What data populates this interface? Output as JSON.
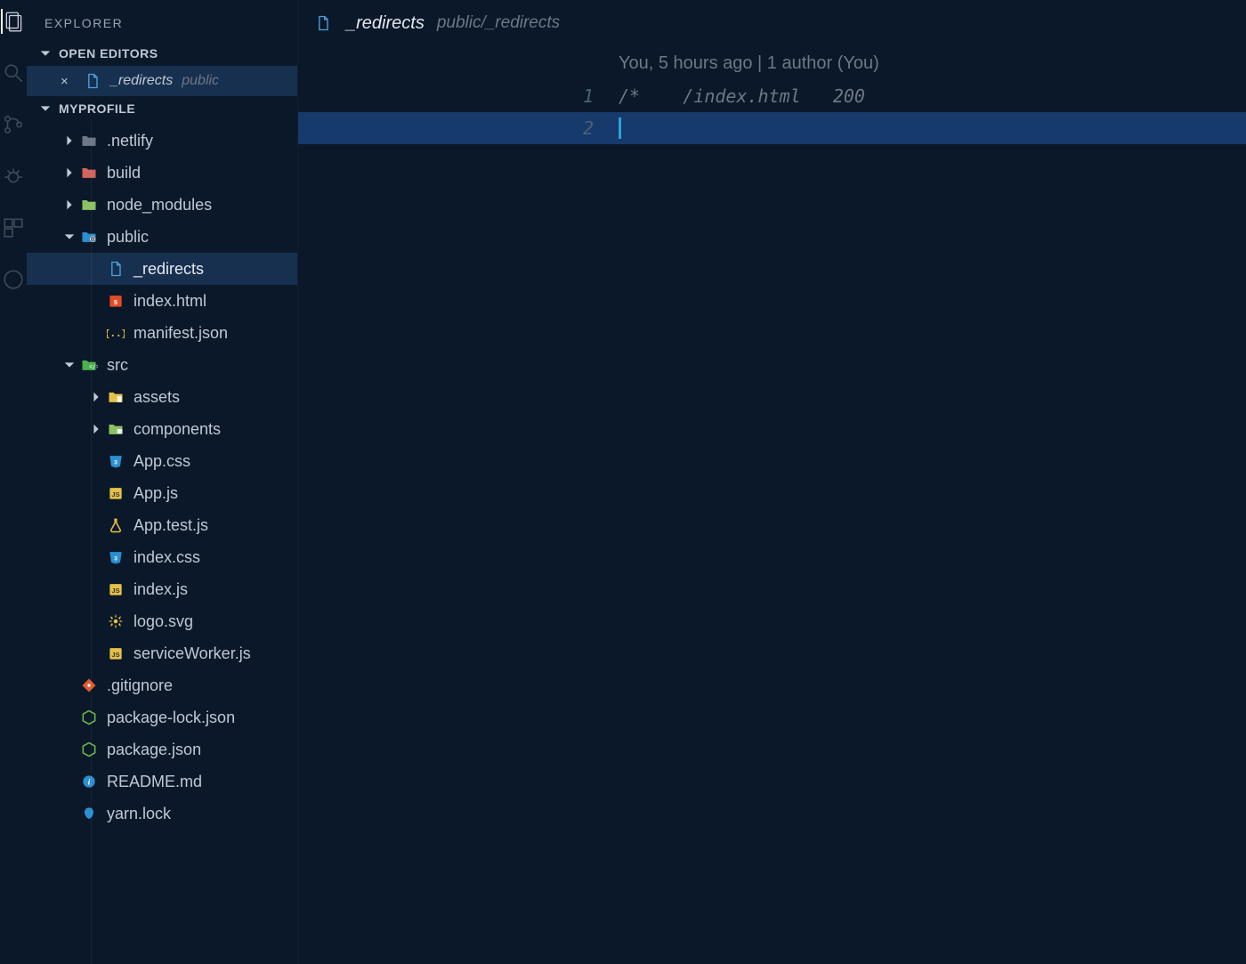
{
  "sidebar": {
    "title": "EXPLORER",
    "open_editors_label": "OPEN EDITORS",
    "open_editor": {
      "name": "_redirects",
      "path": "public"
    },
    "project_label": "MYPROFILE",
    "tree": [
      {
        "lvl": 0,
        "kind": "folder",
        "exp": false,
        "name": ".netlify",
        "icon": "folder-gray"
      },
      {
        "lvl": 0,
        "kind": "folder",
        "exp": false,
        "name": "build",
        "icon": "folder-red"
      },
      {
        "lvl": 0,
        "kind": "folder",
        "exp": false,
        "name": "node_modules",
        "icon": "folder-green"
      },
      {
        "lvl": 0,
        "kind": "folder",
        "exp": true,
        "name": "public",
        "icon": "folder-globe"
      },
      {
        "lvl": 1,
        "kind": "file",
        "name": "_redirects",
        "icon": "file-blue",
        "sel": true
      },
      {
        "lvl": 1,
        "kind": "file",
        "name": "index.html",
        "icon": "html5"
      },
      {
        "lvl": 1,
        "kind": "file",
        "name": "manifest.json",
        "icon": "json-braces"
      },
      {
        "lvl": 0,
        "kind": "folder",
        "exp": true,
        "name": "src",
        "icon": "folder-src"
      },
      {
        "lvl": 1,
        "kind": "folder",
        "exp": false,
        "name": "assets",
        "icon": "folder-assets"
      },
      {
        "lvl": 1,
        "kind": "folder",
        "exp": false,
        "name": "components",
        "icon": "folder-comp"
      },
      {
        "lvl": 1,
        "kind": "file",
        "name": "App.css",
        "icon": "css"
      },
      {
        "lvl": 1,
        "kind": "file",
        "name": "App.js",
        "icon": "js"
      },
      {
        "lvl": 1,
        "kind": "file",
        "name": "App.test.js",
        "icon": "flask"
      },
      {
        "lvl": 1,
        "kind": "file",
        "name": "index.css",
        "icon": "css"
      },
      {
        "lvl": 1,
        "kind": "file",
        "name": "index.js",
        "icon": "js"
      },
      {
        "lvl": 1,
        "kind": "file",
        "name": "logo.svg",
        "icon": "svg"
      },
      {
        "lvl": 1,
        "kind": "file",
        "name": "serviceWorker.js",
        "icon": "js"
      },
      {
        "lvl": 0,
        "kind": "file",
        "name": ".gitignore",
        "icon": "git"
      },
      {
        "lvl": 0,
        "kind": "file",
        "name": "package-lock.json",
        "icon": "node"
      },
      {
        "lvl": 0,
        "kind": "file",
        "name": "package.json",
        "icon": "node"
      },
      {
        "lvl": 0,
        "kind": "file",
        "name": "README.md",
        "icon": "info"
      },
      {
        "lvl": 0,
        "kind": "file",
        "name": "yarn.lock",
        "icon": "yarn"
      }
    ]
  },
  "editor": {
    "tab": {
      "name": "_redirects",
      "path": "public/_redirects"
    },
    "gitlens": "You, 5 hours ago | 1 author (You)",
    "lines": [
      {
        "n": 1,
        "text": "/*    /index.html   200"
      },
      {
        "n": 2,
        "text": "",
        "active": true
      }
    ]
  },
  "icons": {
    "folder-gray": {
      "type": "folder",
      "fill": "#6e7786"
    },
    "folder-red": {
      "type": "folder",
      "fill": "#d4645c"
    },
    "folder-green": {
      "type": "folder",
      "fill": "#8cc265"
    },
    "folder-globe": {
      "type": "folder",
      "fill": "#2b8fd0",
      "badge": "globe"
    },
    "folder-src": {
      "type": "folder",
      "fill": "#4caf50",
      "badge": "code"
    },
    "folder-assets": {
      "type": "folder",
      "fill": "#e6c14a",
      "badge": "doc"
    },
    "folder-comp": {
      "type": "folder",
      "fill": "#8cc265",
      "badge": "brick"
    },
    "file-blue": {
      "type": "file",
      "fill": "#4aa3df"
    },
    "html5": {
      "type": "square",
      "fill": "#e44d26",
      "glyph": "5",
      "gcolor": "#fff"
    },
    "json-braces": {
      "type": "text",
      "glyph": "{..}",
      "gcolor": "#e6c14a"
    },
    "css": {
      "type": "css",
      "fill": "#2b8fd0"
    },
    "js": {
      "type": "square",
      "fill": "#e6c14a",
      "glyph": "JS",
      "gcolor": "#333"
    },
    "flask": {
      "type": "flask",
      "fill": "#e6c14a"
    },
    "svg": {
      "type": "ast",
      "fill": "#e6c14a"
    },
    "git": {
      "type": "diamond",
      "fill": "#dd5a34"
    },
    "node": {
      "type": "hex",
      "fill": "#6cc04a"
    },
    "info": {
      "type": "circle",
      "fill": "#2b8fd0",
      "glyph": "i",
      "gcolor": "#fff"
    },
    "yarn": {
      "type": "blob",
      "fill": "#2b8fd0"
    }
  }
}
